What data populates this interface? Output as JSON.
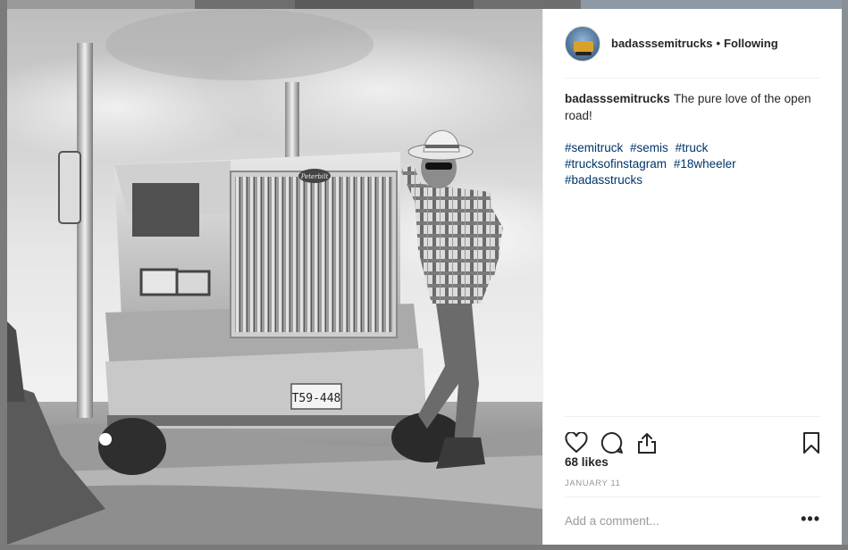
{
  "post": {
    "username": "badasssemitrucks",
    "separator": "•",
    "follow_label": "Following",
    "caption_user": "badasssemitrucks",
    "caption_text": "The pure love of the open road!",
    "hashtags": [
      "#semitruck",
      "#semis",
      "#truck",
      "#trucksofinstagram",
      "#18wheeler",
      "#badasstrucks"
    ],
    "likes": "68 likes",
    "date": "JANUARY 11",
    "license_plate": "T59-448",
    "truck_badge": "Peterbilt"
  },
  "comment": {
    "placeholder": "Add a comment..."
  },
  "icons": {
    "like": "heart-icon",
    "comment": "comment-bubble-icon",
    "share": "share-icon",
    "save": "bookmark-icon",
    "more": "ellipsis-icon"
  },
  "more_label": "•••"
}
